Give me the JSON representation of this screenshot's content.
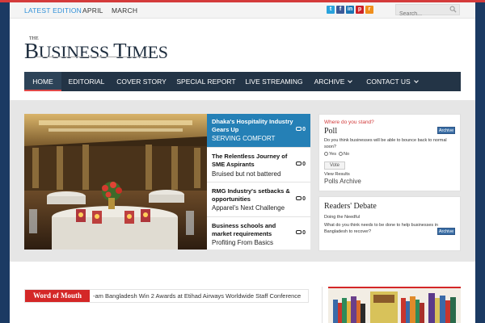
{
  "topbar": {
    "links": [
      "LATEST EDITION",
      "APRIL",
      "MARCH"
    ],
    "social": [
      {
        "name": "twitter",
        "glyph": "t",
        "color": "#29a3dd"
      },
      {
        "name": "facebook",
        "glyph": "f",
        "color": "#3b5a98"
      },
      {
        "name": "linkedin",
        "glyph": "in",
        "color": "#1b76b4"
      },
      {
        "name": "pinterest",
        "glyph": "p",
        "color": "#cc2127"
      },
      {
        "name": "rss",
        "glyph": "r",
        "color": "#f08f1d"
      }
    ],
    "search_placeholder": "Search..."
  },
  "logo": {
    "prefix": "THE",
    "word1_initial": "B",
    "word1_rest": "USINESS",
    "word2_initial": "T",
    "word2_rest": "IMES"
  },
  "nav": {
    "items": [
      "HOME",
      "EDITORIAL",
      "COVER STORY",
      "SPECIAL REPORT",
      "LIVE STREAMING",
      "ARCHIVE",
      "CONTACT US"
    ]
  },
  "featured": [
    {
      "title": "Dhaka's Hospitality Industry Gears Up",
      "subtitle": "SERVING COMFORT",
      "comments": "0"
    },
    {
      "title": "The Relentless Journey of SME Aspirants",
      "subtitle": "Bruised but not battered",
      "comments": "0"
    },
    {
      "title": "RMG Industry's setbacks & opportunities",
      "subtitle": "Apparel's Next Challenge",
      "comments": "0"
    },
    {
      "title": "Business schools and market requirements",
      "subtitle": "Profiting From Basics",
      "comments": "0"
    }
  ],
  "poll": {
    "header": "Where do you stand?",
    "title": "Poll",
    "archive_label": "Archive",
    "question": "Do you think businesses will be able to bounce back to normal soon?",
    "options": [
      "Yes",
      "No"
    ],
    "vote_label": "Vote",
    "view_results": "View Results",
    "polls_archive": "Polls Archive"
  },
  "debate": {
    "title": "Readers' Debate",
    "archive_label": "Archive",
    "subhead": "Doing the Needful",
    "question": "What do you think needs to be done to help businesses in Bangladesh to recover?"
  },
  "word_of_mouth": {
    "label": "Word of Mouth",
    "ticker": "-am Bangladesh Win 2 Awards at Etihad Airways Worldwide Staff Conference"
  },
  "colors": {
    "accent_red": "#d42727",
    "nav_bg": "#233446",
    "feature_blue": "#2580b6",
    "page_bg": "#1b3a63"
  }
}
